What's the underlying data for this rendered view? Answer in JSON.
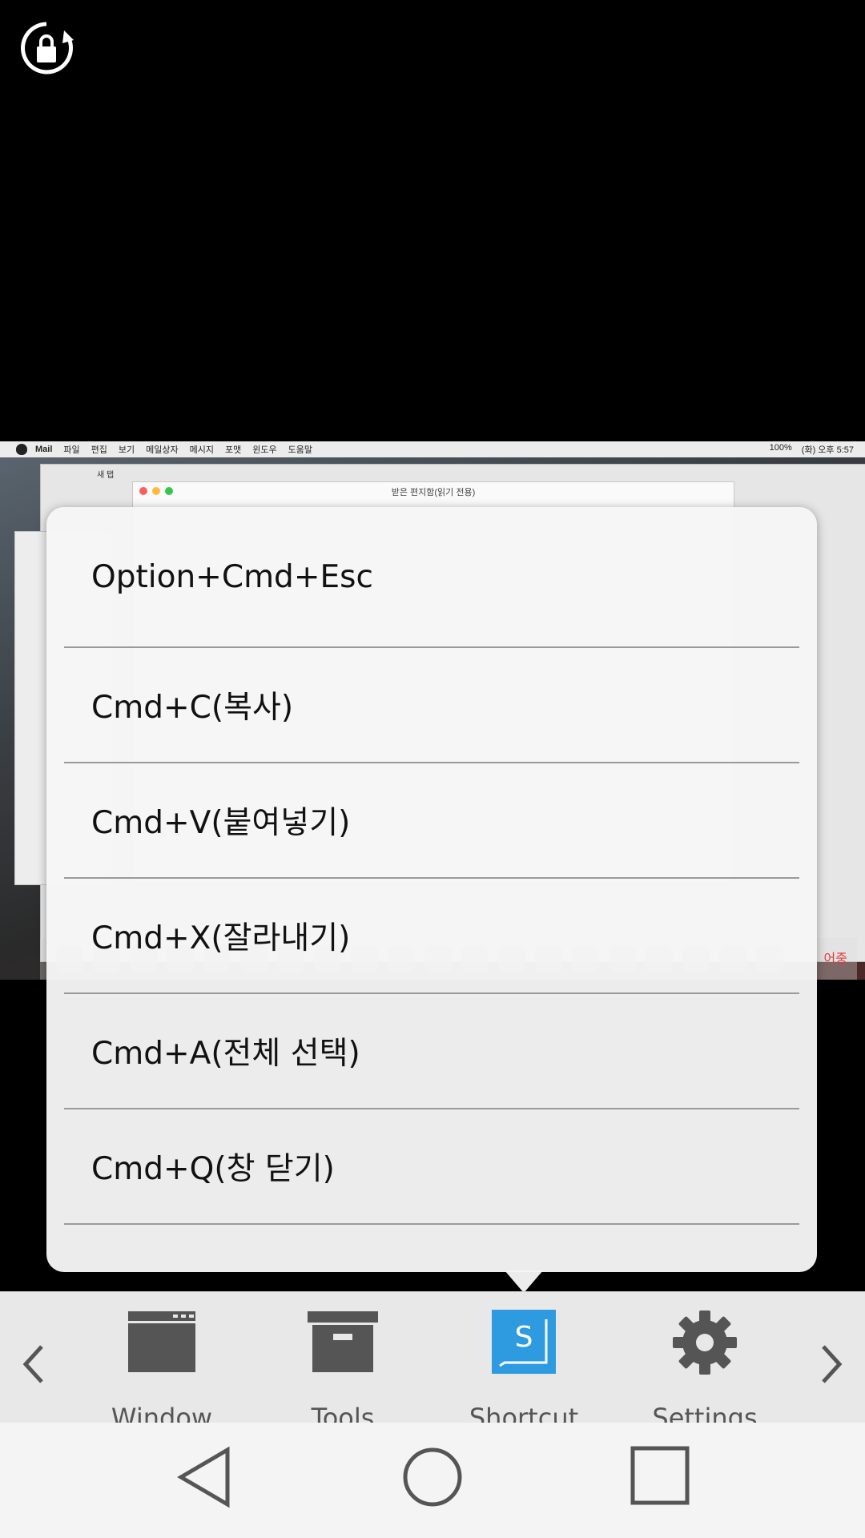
{
  "status": {
    "rotation_lock_icon": "rotation-lock-icon"
  },
  "remote_screen": {
    "menubar": {
      "app": "Mail",
      "menus": [
        "파일",
        "편집",
        "보기",
        "메일상자",
        "메시지",
        "포맷",
        "윈도우",
        "도움말"
      ],
      "battery": "100%",
      "clock": "(화) 오후 5:57"
    },
    "browser_tab": "새 탭",
    "mail_window_title": "받은 편지함(읽기 전용)",
    "recording_label": "어중"
  },
  "shortcut_menu": {
    "items": [
      {
        "label": "Option+Cmd+Esc"
      },
      {
        "label": "Cmd+C(복사)"
      },
      {
        "label": "Cmd+V(붙여넣기)"
      },
      {
        "label": "Cmd+X(잘라내기)"
      },
      {
        "label": "Cmd+A(전체 선택)"
      },
      {
        "label": "Cmd+Q(창 닫기)"
      }
    ]
  },
  "toolbar": {
    "prev_icon": "chevron-left-icon",
    "next_icon": "chevron-right-icon",
    "tools": [
      {
        "label": "Window",
        "icon": "window-icon"
      },
      {
        "label": "Tools",
        "icon": "toolbox-icon"
      },
      {
        "label": "Shortcut",
        "icon": "shortcut-icon",
        "active": true
      },
      {
        "label": "Settings",
        "icon": "gear-icon"
      }
    ],
    "accent_color": "#2e9be0"
  },
  "navbar": {
    "back_icon": "back-triangle-icon",
    "home_icon": "home-circle-icon",
    "recents_icon": "recents-square-icon"
  }
}
